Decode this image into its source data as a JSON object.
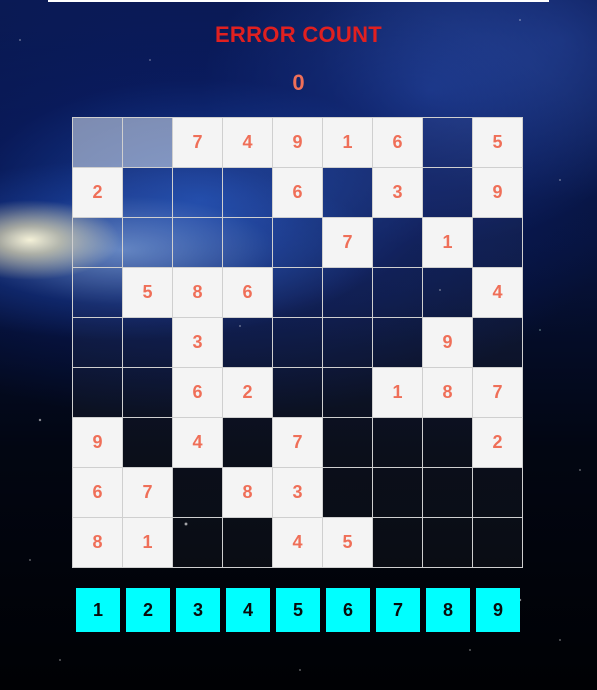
{
  "header": {
    "error_label": "ERROR COUNT",
    "error_count": "0"
  },
  "board": [
    [
      "",
      "",
      "7",
      "4",
      "9",
      "1",
      "6",
      "",
      "5"
    ],
    [
      "2",
      "",
      "",
      "",
      "6",
      "",
      "3",
      "",
      "9"
    ],
    [
      "",
      "",
      "",
      "",
      "",
      "7",
      "",
      "1",
      ""
    ],
    [
      "",
      "5",
      "8",
      "6",
      "",
      "",
      "",
      "",
      "4"
    ],
    [
      "",
      "",
      "3",
      "",
      "",
      "",
      "",
      "9",
      ""
    ],
    [
      "",
      "",
      "6",
      "2",
      "",
      "",
      "1",
      "8",
      "7"
    ],
    [
      "9",
      "",
      "4",
      "",
      "7",
      "",
      "",
      "",
      "2"
    ],
    [
      "6",
      "7",
      "",
      "8",
      "3",
      "",
      "",
      "",
      ""
    ],
    [
      "8",
      "1",
      "",
      "",
      "4",
      "5",
      "",
      "",
      ""
    ]
  ],
  "picker": [
    "1",
    "2",
    "3",
    "4",
    "5",
    "6",
    "7",
    "8",
    "9"
  ],
  "colors": {
    "title": "#e02020",
    "digits": "#ef6f58",
    "picker_bg": "#00ffff"
  }
}
